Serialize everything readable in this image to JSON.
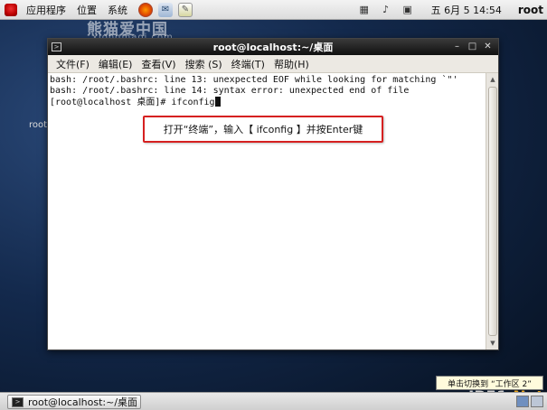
{
  "top_panel": {
    "menus": [
      "应用程序",
      "位置",
      "系统"
    ],
    "clock": "五 6月  5 14:54",
    "user": "root",
    "launchers": [
      "firefox-icon",
      "mail-icon",
      "text-editor-icon"
    ],
    "tray": [
      "network-icon",
      "volume-icon",
      "display-icon"
    ]
  },
  "watermark": {
    "title": "熊猫爱中国",
    "subtitle": "xiongmaoi.com"
  },
  "window": {
    "title": "root@localhost:~/桌面",
    "menus": [
      "文件(F)",
      "编辑(E)",
      "查看(V)",
      "搜索 (S)",
      "终端(T)",
      "帮助(H)"
    ],
    "terminal_lines": [
      "bash: /root/.bashrc: line 13: unexpected EOF while looking for matching `\"'",
      "bash: /root/.bashrc: line 14: syntax error: unexpected end of file",
      "[root@localhost 桌面]# ifconfig"
    ]
  },
  "callout": "打开“终端”，输入【 ifconfig 】并按Enter键",
  "desktop_label": "root",
  "tooltip": "单击切换到 “工作区 2”",
  "site_mark": {
    "main": "JB51",
    "suffix": ".Net"
  },
  "taskbar": {
    "window_button": "root@localhost:~/桌面"
  }
}
